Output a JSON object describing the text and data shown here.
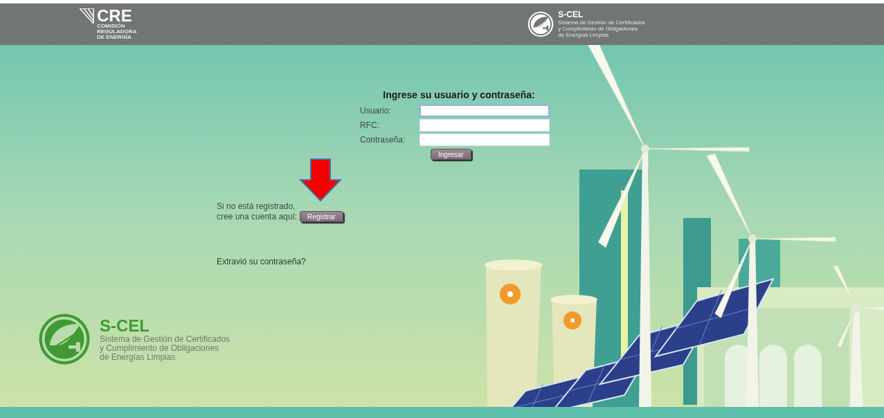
{
  "header": {
    "cre_logo": {
      "title": "CRE",
      "subtitle_lines": [
        "COMISIÓN",
        "REGULADORA",
        "DE ENERGÍA"
      ]
    },
    "scel_logo": {
      "title": "S-CEL",
      "subtitle_lines": [
        "Sistema de Gestión de Certificados",
        "y Cumplimiento de Obligaciones",
        "de Energías Limpias"
      ]
    }
  },
  "login": {
    "heading": "Ingrese su usuario y contraseña:",
    "fields": [
      {
        "label": "Usuario:",
        "focused": true
      },
      {
        "label": "RFC:",
        "focused": false
      },
      {
        "label": "Contraseña:",
        "focused": false
      }
    ],
    "submit": "Ingresar"
  },
  "register": {
    "lines": [
      "Si no está registrado,",
      "cree una cuenta aquí:"
    ],
    "button": "Registrar"
  },
  "forgot_link": "Extravió su contraseña?",
  "footer_logo": {
    "title": "S-CEL",
    "subtitle_lines": [
      "Sistema de Gestión de Certificados",
      "y Cumplimiento de Obligaciones",
      "de Energías Limpias"
    ]
  }
}
